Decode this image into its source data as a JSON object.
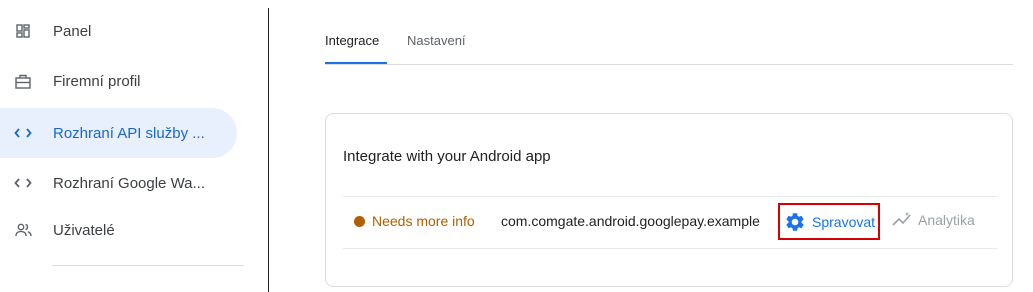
{
  "sidebar": {
    "items": [
      {
        "label": "Panel",
        "icon": "dashboard-icon",
        "active": false
      },
      {
        "label": "Firemní profil",
        "icon": "briefcase-icon",
        "active": false
      },
      {
        "label": "Rozhraní API služby ...",
        "icon": "code-icon",
        "active": true
      },
      {
        "label": "Rozhraní Google Wa...",
        "icon": "code-icon",
        "active": false
      },
      {
        "label": "Uživatelé",
        "icon": "people-icon",
        "active": false
      }
    ]
  },
  "tabs": [
    {
      "label": "Integrace",
      "active": true
    },
    {
      "label": "Nastavení",
      "active": false
    }
  ],
  "card": {
    "title": "Integrate with your Android app",
    "row": {
      "status": "Needs more info",
      "package": "com.comgate.android.googlepay.example",
      "manage_label": "Spravovat",
      "analytics_label": "Analytika"
    }
  },
  "colors": {
    "accent": "#1a73e8",
    "active_bg": "#e8f0fe",
    "status_warning": "#b06000",
    "highlight_border": "#d50000",
    "disabled": "#9aa0a6"
  }
}
